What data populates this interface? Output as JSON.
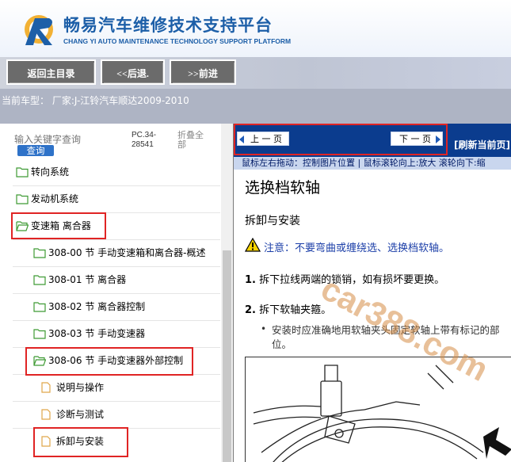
{
  "header": {
    "title_cn": "畅易汽车维修技术支持平台",
    "title_en": "CHANG YI AUTO MAINTENANCE TECHNOLOGY SUPPORT PLATFORM"
  },
  "toolbar": {
    "home_label": "返回主目录",
    "back_label": "<<后退.",
    "forward_label": ">>前进"
  },
  "car_model": {
    "text": "当前车型： 厂家:J-江铃汽车顺达2009-2010"
  },
  "left_panel": {
    "search": {
      "placeholder": "输入关键字查询",
      "button_label": "查询"
    },
    "pc_code": "PC.34-28541",
    "collapse_all_label": "折叠全部",
    "tree": [
      {
        "label": "转向系统",
        "icon": "folder-icon"
      },
      {
        "label": "发动机系统",
        "icon": "folder-icon"
      },
      {
        "label": "变速箱 离合器",
        "icon": "folder-open-icon"
      },
      {
        "label": "308-00 节 手动变速箱和离合器-概述",
        "icon": "folder-icon"
      },
      {
        "label": "308-01 节 离合器",
        "icon": "folder-icon"
      },
      {
        "label": "308-02 节 离合器控制",
        "icon": "folder-icon"
      },
      {
        "label": "308-03 节 手动变速器",
        "icon": "folder-icon"
      },
      {
        "label": "308-06 节 手动变速器外部控制",
        "icon": "folder-open-icon"
      },
      {
        "label": "说明与操作",
        "icon": "page-icon"
      },
      {
        "label": "诊断与测试",
        "icon": "page-icon"
      },
      {
        "label": "拆卸与安装",
        "icon": "page-icon"
      }
    ]
  },
  "content_panel": {
    "prev_label": "上 一 页",
    "next_label": "下 一 页",
    "refresh_label": "[刷新当前页]",
    "hint_text": "鼠标左右拖动：控制图片位置 | 鼠标滚轮向上:放大   滚轮向下:缩",
    "doc": {
      "title": "选换档软轴",
      "subtitle": "拆卸与安装",
      "warning": "注意：不要弯曲或缠绕选、选换档软轴。",
      "steps": [
        {
          "num": "1.",
          "text": "拆下拉线两端的锁销，如有损坏要更换。"
        },
        {
          "num": "2.",
          "text": "拆下软轴夹箍。"
        }
      ],
      "bullet": "安装时应准确地用软轴夹头固定软轴上带有标记的部位。"
    },
    "watermark": "car388.com"
  },
  "colors": {
    "header_blue": "#1d5fa8",
    "nav_blue": "#0b3c8e",
    "highlight_red": "#e02424",
    "warning_blue": "#1c3fa8"
  }
}
